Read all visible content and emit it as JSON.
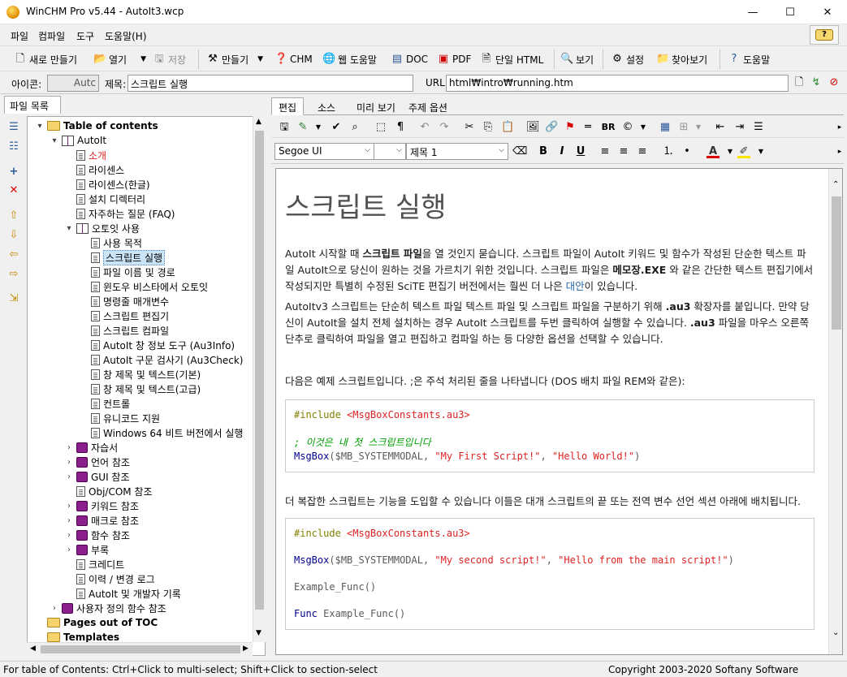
{
  "window": {
    "title": "WinCHM Pro v5.44 - AutoIt3.wcp",
    "minimize": "—",
    "maximize": "☐",
    "close": "✕"
  },
  "menu": [
    "파일",
    "컴파일",
    "도구",
    "도움말(H)"
  ],
  "toolbar": {
    "new": "새로 만들기",
    "open": "열기",
    "save": "저장",
    "build": "만들기",
    "chm": "CHM",
    "webhelp": "웹 도움말",
    "doc": "DOC",
    "pdf": "PDF",
    "single_html": "단일 HTML",
    "view": "보기",
    "settings": "설정",
    "find": "찾아보기",
    "help": "도움말"
  },
  "props": {
    "icon_label": "아이콘:",
    "icon_value": "Autc",
    "title_label": "제목:",
    "title_value": "스크립트 실행",
    "url_label": "URL:",
    "url_value": "html₩intro₩running.htm"
  },
  "left_tab": "파일 목록",
  "tree": [
    {
      "label": "Table of contents",
      "bold": true,
      "icon": "folder",
      "exp": "▾",
      "level": 0
    },
    {
      "label": "AutoIt",
      "icon": "bookopen",
      "exp": "▾",
      "level": 1
    },
    {
      "label": "소개",
      "icon": "page",
      "level": 2,
      "color": "#dd2222"
    },
    {
      "label": "라이센스",
      "icon": "page",
      "level": 2
    },
    {
      "label": "라이센스(한글)",
      "icon": "page",
      "level": 2
    },
    {
      "label": "설치 디렉터리",
      "icon": "page",
      "level": 2
    },
    {
      "label": "자주하는 질문 (FAQ)",
      "icon": "page",
      "level": 2
    },
    {
      "label": "오토잇 사용",
      "icon": "bookopen",
      "exp": "▾",
      "level": 2
    },
    {
      "label": "사용 목적",
      "icon": "page",
      "level": 3
    },
    {
      "label": "스크립트 실행",
      "icon": "page",
      "level": 3,
      "selected": true
    },
    {
      "label": "파일 이름 및 경로",
      "icon": "page",
      "level": 3
    },
    {
      "label": "윈도우 비스타에서 오토잇",
      "icon": "page",
      "level": 3
    },
    {
      "label": "명령줄 매개변수",
      "icon": "page",
      "level": 3
    },
    {
      "label": "스크립트 편집기",
      "icon": "page",
      "level": 3
    },
    {
      "label": "스크립트 컴파일",
      "icon": "page",
      "level": 3
    },
    {
      "label": "AutoIt 창 정보 도구 (Au3Info)",
      "icon": "page",
      "level": 3
    },
    {
      "label": "AutoIt 구문 검사기 (Au3Check)",
      "icon": "page",
      "level": 3
    },
    {
      "label": "창 제목 및 텍스트(기본)",
      "icon": "page",
      "level": 3
    },
    {
      "label": "창 제목 및 텍스트(고급)",
      "icon": "page",
      "level": 3
    },
    {
      "label": "컨트롤",
      "icon": "page",
      "level": 3
    },
    {
      "label": "유니코드 지원",
      "icon": "page",
      "level": 3
    },
    {
      "label": "Windows 64 비트 버전에서 실행",
      "icon": "page",
      "level": 3
    },
    {
      "label": "자습서",
      "icon": "book",
      "exp": "›",
      "level": 2
    },
    {
      "label": "언어 참조",
      "icon": "book",
      "exp": "›",
      "level": 2
    },
    {
      "label": "GUI 참조",
      "icon": "book",
      "exp": "›",
      "level": 2
    },
    {
      "label": "Obj/COM 참조",
      "icon": "page",
      "level": 2
    },
    {
      "label": "키워드 참조",
      "icon": "book",
      "exp": "›",
      "level": 2
    },
    {
      "label": "매크로 참조",
      "icon": "book",
      "exp": "›",
      "level": 2
    },
    {
      "label": "함수 참조",
      "icon": "book",
      "exp": "›",
      "level": 2
    },
    {
      "label": "부록",
      "icon": "book",
      "exp": "›",
      "level": 2
    },
    {
      "label": "크레디트",
      "icon": "page",
      "level": 2
    },
    {
      "label": "이력 / 변경 로그",
      "icon": "page",
      "level": 2
    },
    {
      "label": "AutoIt 및 개발자 기록",
      "icon": "page",
      "level": 2
    },
    {
      "label": "사용자 정의 함수 참조",
      "icon": "book",
      "exp": "›",
      "level": 1
    },
    {
      "label": "Pages out of TOC",
      "bold": true,
      "icon": "folder",
      "level": 0
    },
    {
      "label": "Templates",
      "bold": true,
      "icon": "folder",
      "level": 0
    }
  ],
  "right_tabs": [
    "편집",
    "소스",
    "미리 보기",
    "주제 옵션"
  ],
  "editor": {
    "font": "Segoe UI",
    "size": "",
    "style": "제목 1",
    "br": "BR"
  },
  "doc": {
    "heading": "스크립트 실행",
    "p1_a": "AutoIt 시작할 때 ",
    "p1_b": "스크립트 파일",
    "p1_c": "을 열 것인지 묻습니다. 스크립트 파일이 AutoIt 키워드 및 함수가 작성된 단순한 텍스트 파일 AutoIt으로 당신이 원하는 것을 가르치기 위한 것입니다. 스크립트 파일은 ",
    "p1_d": "메모장.EXE",
    "p1_e": " 와 같은 간단한 텍스트 편집기에서 작성되지만 특별히 수정된 SciTE 편집기 버전에서는 훨씬 더 나은 ",
    "p1_link": "대안",
    "p1_f": "이 있습니다.",
    "p2_a": "AutoItv3 스크립트는 단순히 텍스트 파일 텍스트 파일 및 스크립트 파일을 구분하기 위해 ",
    "p2_b": ".au3",
    "p2_c": " 확장자를 붙입니다. 만약 당신이 AutoIt을 설치 전체 설치하는 경우 AutoIt 스크립트를 두번 클릭하여 실행할 수 있습니다. ",
    "p2_d": ".au3",
    "p2_e": " 파일을 마우스 오른쪽 단추로 클릭하여 파일을 열고 편집하고 컴파일 하는 등 다양한 옵션을 선택할 수 있습니다.",
    "p3": "다음은 예제 스크립트입니다. ;은 주석 처리된 줄을 나타냅니다 (DOS 배치 파일 REM와 같은):",
    "code1_inc": "#include",
    "code1_file": "<MsgBoxConstants.au3>",
    "code1_comment": "; 이것은 내 첫 스크립트입니다",
    "code1_fn": "MsgBox",
    "code1_var": "$MB_SYSTEMMODAL",
    "code1_s1": "\"My First Script!\"",
    "code1_s2": "\"Hello World!\"",
    "p4": "더 복잡한 스크립트는 기능을 도입할 수 있습니다 이들은 대개 스크립트의 끝 또는 전역 변수 선언 섹션 아래에 배치됩니다.",
    "code2_inc": "#include",
    "code2_file": "<MsgBoxConstants.au3>",
    "code2_fn": "MsgBox",
    "code2_var": "$MB_SYSTEMMODAL",
    "code2_s1": "\"My second script!\"",
    "code2_s2": "\"Hello from the main script!\"",
    "code2_call": "Example_Func()",
    "code2_func_kw": "Func",
    "code2_func_name": "Example_Func()"
  },
  "status": {
    "left": "For table of Contents: Ctrl+Click to multi-select; Shift+Click to section-select",
    "right": "Copyright 2003-2020 Softany Software"
  }
}
